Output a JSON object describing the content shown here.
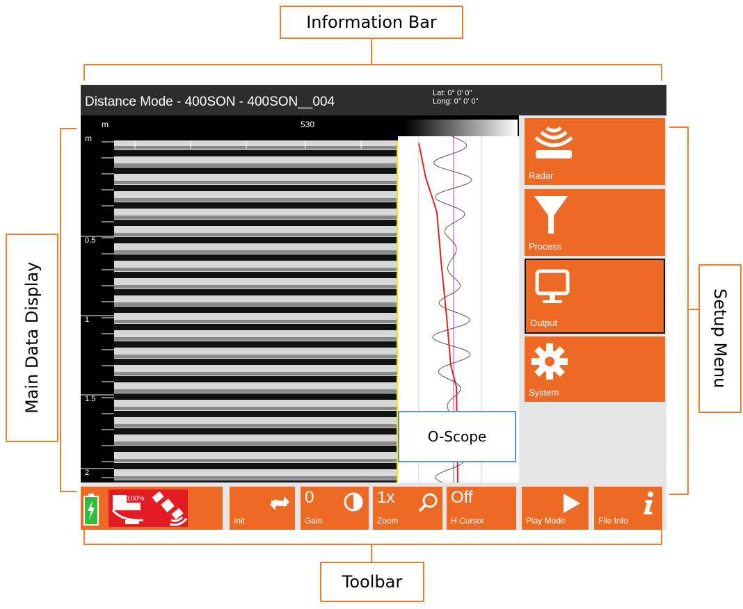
{
  "callouts": {
    "information_bar": "Information Bar",
    "main_data_display": "Main Data Display",
    "setup_menu": "Setup Menu",
    "toolbar": "Toolbar",
    "o_scope": "O-Scope"
  },
  "infobar": {
    "title": "Distance Mode - 400SON - 400SON__004",
    "lat": "Lat: 0° 0' 0\"",
    "long": "Long: 0° 0' 0\""
  },
  "display": {
    "x_unit": "m",
    "x_tick": "530",
    "y_unit": "m",
    "depth_labels": [
      "0.5",
      "1",
      "1.5",
      "2"
    ]
  },
  "menu": {
    "items": [
      {
        "label": "Radar",
        "icon": "radar-icon"
      },
      {
        "label": "Process",
        "icon": "filter-funnel-icon"
      },
      {
        "label": "Output",
        "icon": "monitor-icon",
        "selected": true
      },
      {
        "label": "System",
        "icon": "gear-icon"
      }
    ]
  },
  "toolbar": {
    "battery_percent": "100%",
    "init": {
      "label": "Init",
      "icon": "refresh-arrows-icon"
    },
    "gain": {
      "value": "0",
      "label": "Gain",
      "icon": "contrast-icon"
    },
    "zoom": {
      "value": "1x",
      "label": "Zoom",
      "icon": "magnifier-icon"
    },
    "hcursor": {
      "value": "Off",
      "label": "H Cursor"
    },
    "playmode": {
      "label": "Play Mode",
      "icon": "play-icon"
    },
    "fileinfo": {
      "label": "File Info",
      "icon": "info-icon"
    }
  },
  "colors": {
    "accent": "#ED6A25",
    "callout_border": "#ED7D31",
    "infobar_bg": "#2d2d2d"
  }
}
